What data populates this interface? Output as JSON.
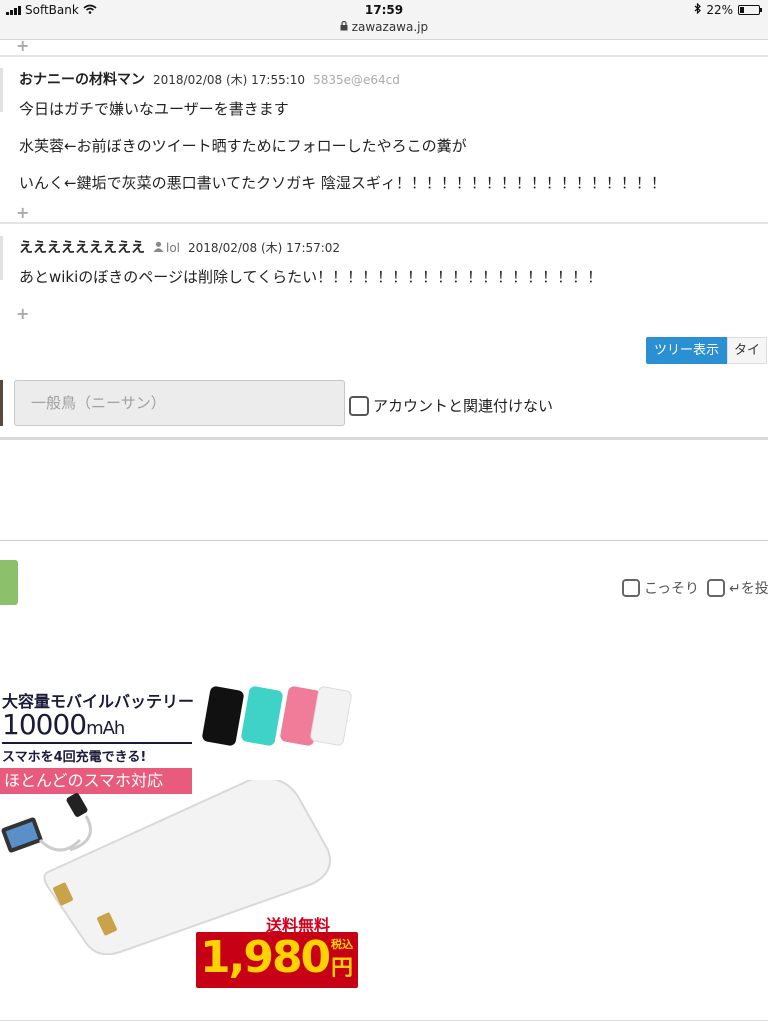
{
  "status_bar": {
    "carrier": "SoftBank",
    "time": "17:59",
    "url": "zawazawa.jp",
    "battery": "22%",
    "battery_level": 0.22
  },
  "posts": [
    {
      "author": "おナニーの材料マン",
      "datetime": "2018/02/08 (木) 17:55:10",
      "user_id": "5835e@e64cd",
      "lines": [
        "今日はガチで嫌いなユーザーを書きます",
        "水芙蓉←お前ぼきのツイート晒すためにフォローしたやろこの糞が",
        "いんく←鍵垢で灰菜の悪口書いてたクソガキ 陰湿スギィ！！！！！！！！！！！！！！！！！！"
      ]
    },
    {
      "author": "えええええええええ",
      "badge": "lol",
      "datetime": "2018/02/08 (木) 17:57:02",
      "lines": [
        "あとwikiのぼきのページは削除してくらたい！！！！！！！！！！！！！！！！！！！"
      ]
    }
  ],
  "view_toggle": {
    "tree": "ツリー表示",
    "time": "タイ"
  },
  "form": {
    "name_placeholder": "一般鳥（ニーサン）",
    "no_account_label": "アカウントと関連付けない",
    "sneak_label": "こっそり",
    "enter_label": "↵を投"
  },
  "ad": {
    "headline": "大容量モバイルバッテリー",
    "capacity": "10000",
    "capacity_unit": "mAh",
    "subline": "スマホを4回充電できる!",
    "band": "ほとんどのスマホ対応",
    "shipping": "送料無料",
    "price": "1,980",
    "tax": "税込",
    "yen": "円",
    "phone_colors": [
      "#111111",
      "#3fd3c8",
      "#ef7d9a",
      "#f2f2f2"
    ]
  }
}
